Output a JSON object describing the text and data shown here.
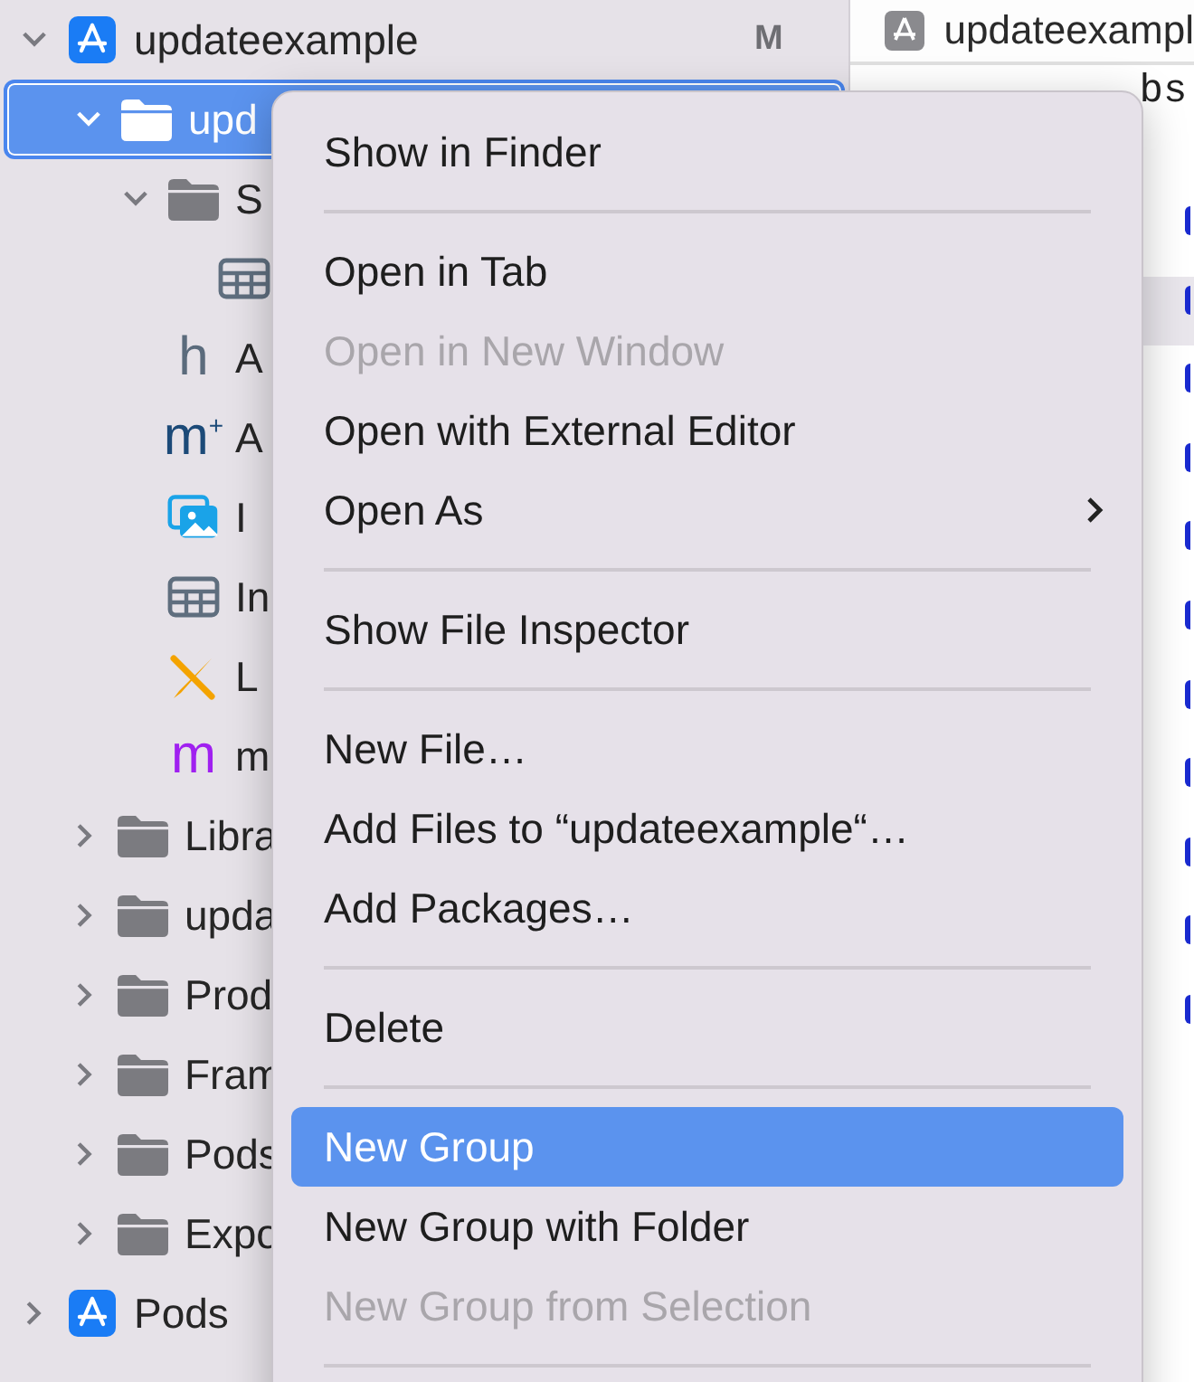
{
  "navigator": {
    "items": [
      {
        "label": "updateexample",
        "kind": "app",
        "badge": "M",
        "expanded": true,
        "selected": false,
        "children": [
          {
            "label": "upd",
            "kind": "folder",
            "expanded": true,
            "selected": true,
            "children": [
              {
                "label": "S",
                "kind": "folder",
                "expanded": true,
                "selected": false,
                "children": [
                  {
                    "kind": "table",
                    "selected": false
                  }
                ]
              },
              {
                "label": "A",
                "kind": "header",
                "glyph": "h",
                "selected": false
              },
              {
                "label": "A",
                "kind": "source",
                "glyph": "m$^{+}$",
                "selected": false
              },
              {
                "label": "I",
                "kind": "images",
                "selected": false
              },
              {
                "label": "In",
                "kind": "table",
                "selected": false
              },
              {
                "label": "L",
                "kind": "launch",
                "selected": false
              },
              {
                "label": "m",
                "kind": "objc",
                "glyph": "m",
                "selected": false
              }
            ]
          },
          {
            "label": "Libra",
            "kind": "folder",
            "expanded": false,
            "selected": false
          },
          {
            "label": "upda",
            "kind": "folder",
            "expanded": false,
            "selected": false
          },
          {
            "label": "Prod",
            "kind": "folder",
            "expanded": false,
            "selected": false
          },
          {
            "label": "Fram",
            "kind": "folder",
            "expanded": false,
            "selected": false
          },
          {
            "label": "Pods",
            "kind": "folder",
            "expanded": false,
            "selected": false
          },
          {
            "label": "Expo",
            "kind": "folder",
            "expanded": false,
            "selected": false
          }
        ]
      },
      {
        "label": "Pods",
        "kind": "app",
        "expanded": false,
        "selected": false
      }
    ]
  },
  "editor": {
    "tab": "updateexampl",
    "code_fragment": "bs"
  },
  "context_menu": {
    "items": [
      {
        "kind": "item",
        "label": "Show in Finder",
        "disabled": false,
        "selected": false
      },
      {
        "kind": "separator"
      },
      {
        "kind": "item",
        "label": "Open in Tab",
        "disabled": false,
        "selected": false
      },
      {
        "kind": "item",
        "label": "Open in New Window",
        "disabled": true,
        "selected": false
      },
      {
        "kind": "item",
        "label": "Open with External Editor",
        "disabled": false,
        "selected": false
      },
      {
        "kind": "item",
        "label": "Open As",
        "disabled": false,
        "selected": false,
        "submenu": true
      },
      {
        "kind": "separator"
      },
      {
        "kind": "item",
        "label": "Show File Inspector",
        "disabled": false,
        "selected": false
      },
      {
        "kind": "separator"
      },
      {
        "kind": "item",
        "label": "New File…",
        "disabled": false,
        "selected": false
      },
      {
        "kind": "item",
        "label": "Add Files to “updateexample“…",
        "disabled": false,
        "selected": false
      },
      {
        "kind": "item",
        "label": "Add Packages…",
        "disabled": false,
        "selected": false
      },
      {
        "kind": "separator"
      },
      {
        "kind": "item",
        "label": "Delete",
        "disabled": false,
        "selected": false
      },
      {
        "kind": "separator"
      },
      {
        "kind": "item",
        "label": "New Group",
        "disabled": false,
        "selected": true
      },
      {
        "kind": "item",
        "label": "New Group with Folder",
        "disabled": false,
        "selected": false
      },
      {
        "kind": "item",
        "label": "New Group from Selection",
        "disabled": true,
        "selected": false
      },
      {
        "kind": "separator"
      }
    ]
  }
}
